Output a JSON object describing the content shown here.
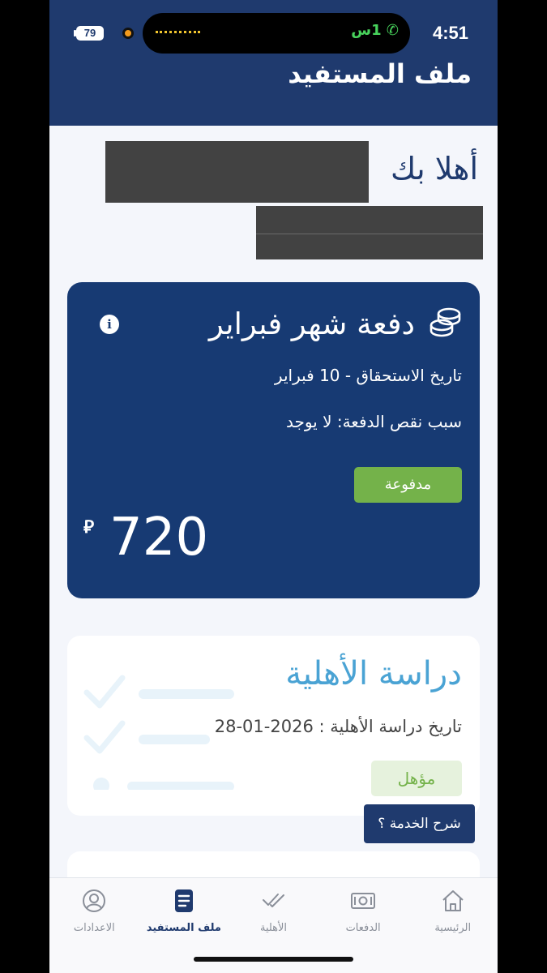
{
  "status_bar": {
    "time": "4:51",
    "call_duration": "1س",
    "battery": "79"
  },
  "header": {
    "title": "ملف المستفيد"
  },
  "greeting": "أهلا بك",
  "payment": {
    "title": "دفعة شهر فبراير",
    "due_date": "تاريخ الاستحقاق - 10 فبراير",
    "shortfall_reason": "سبب نقص الدفعة: لا يوجد",
    "status": "مدفوعة",
    "amount": "720",
    "currency_symbol": "⃁",
    "colors": {
      "card": "#173a73",
      "paid": "#74b24a"
    }
  },
  "eligibility": {
    "title": "دراسة الأهلية",
    "date": "تاريخ دراسة الأهلية : 2026-01-28",
    "status": "مؤهل",
    "colors": {
      "title": "#4aa3d4",
      "badge_text": "#74b24a",
      "badge_bg": "#e6f2dd"
    }
  },
  "service_button": "شرح الخدمة ؟",
  "bottom_nav": {
    "items": [
      {
        "label": "الرئيسية",
        "icon": "home-icon"
      },
      {
        "label": "الدفعات",
        "icon": "cash-icon"
      },
      {
        "label": "الأهلية",
        "icon": "checkmark-icon"
      },
      {
        "label": "ملف المستفيد",
        "icon": "document-icon",
        "active": true
      },
      {
        "label": "الاعدادات",
        "icon": "user-circle-icon"
      }
    ]
  },
  "theme": {
    "primary": "#1f3a6e",
    "background": "#f4f6fb"
  }
}
